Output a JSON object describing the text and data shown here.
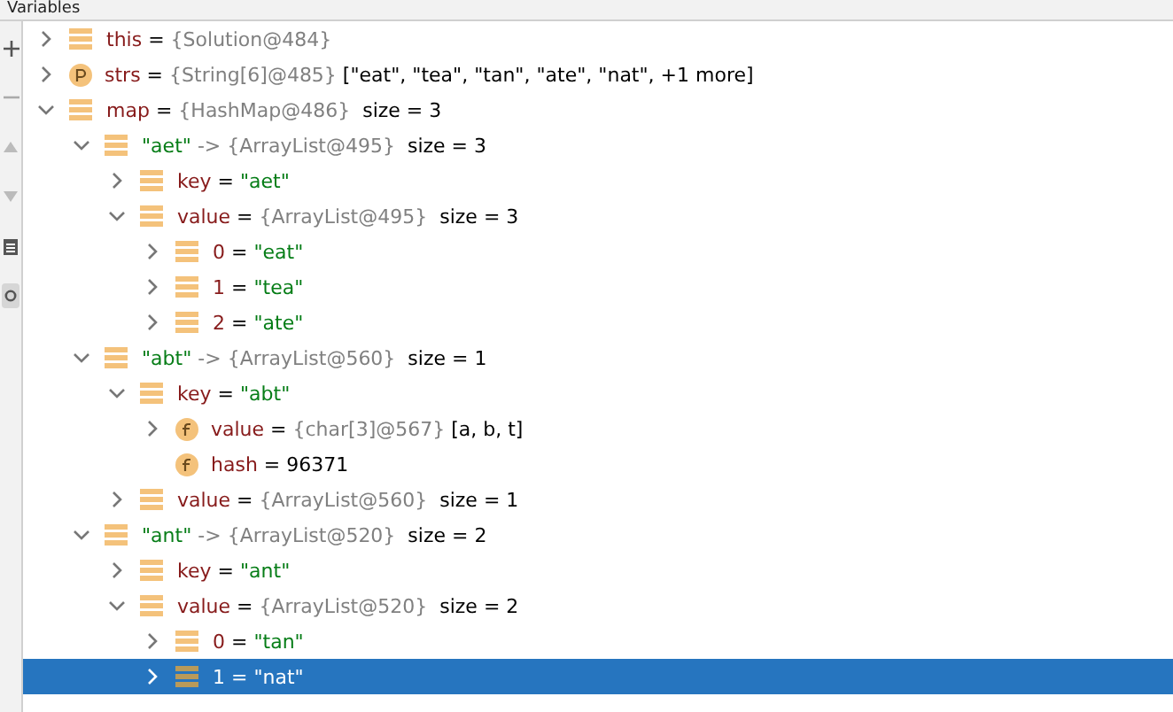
{
  "panel": {
    "title": "Variables"
  },
  "tree": [
    {
      "kind": "list",
      "expanded": false,
      "selected": false,
      "parts": [
        {
          "kind": "name",
          "text": "this"
        },
        {
          "kind": "op",
          "text": " = "
        },
        {
          "kind": "ref",
          "text": "{Solution@484}"
        }
      ]
    },
    {
      "kind": "parameter",
      "expanded": false,
      "selected": false,
      "parts": [
        {
          "kind": "name",
          "text": "strs"
        },
        {
          "kind": "op",
          "text": " = "
        },
        {
          "kind": "ref",
          "text": "{String[6]@485}"
        },
        {
          "kind": "value",
          "text": " [\"eat\", \"tea\", \"tan\", \"ate\", \"nat\", +1 more]"
        }
      ]
    },
    {
      "kind": "list",
      "expanded": true,
      "selected": false,
      "parts": [
        {
          "kind": "name",
          "text": "map"
        },
        {
          "kind": "op",
          "text": " = "
        },
        {
          "kind": "ref",
          "text": "{HashMap@486}"
        },
        {
          "kind": "value",
          "text": "  size = 3"
        }
      ],
      "children": [
        {
          "kind": "list",
          "expanded": true,
          "selected": false,
          "parts": [
            {
              "kind": "string",
              "text": "\"aet\""
            },
            {
              "kind": "ref",
              "text": " -> {ArrayList@495}"
            },
            {
              "kind": "value",
              "text": "  size = 3"
            }
          ],
          "children": [
            {
              "kind": "list",
              "expanded": false,
              "selected": false,
              "parts": [
                {
                  "kind": "name",
                  "text": "key"
                },
                {
                  "kind": "op",
                  "text": " = "
                },
                {
                  "kind": "string",
                  "text": "\"aet\""
                }
              ]
            },
            {
              "kind": "list",
              "expanded": true,
              "selected": false,
              "parts": [
                {
                  "kind": "name",
                  "text": "value"
                },
                {
                  "kind": "op",
                  "text": " = "
                },
                {
                  "kind": "ref",
                  "text": "{ArrayList@495}"
                },
                {
                  "kind": "value",
                  "text": "  size = 3"
                }
              ],
              "children": [
                {
                  "kind": "list",
                  "expanded": false,
                  "selected": false,
                  "parts": [
                    {
                      "kind": "name",
                      "text": "0"
                    },
                    {
                      "kind": "op",
                      "text": " = "
                    },
                    {
                      "kind": "string",
                      "text": "\"eat\""
                    }
                  ]
                },
                {
                  "kind": "list",
                  "expanded": false,
                  "selected": false,
                  "parts": [
                    {
                      "kind": "name",
                      "text": "1"
                    },
                    {
                      "kind": "op",
                      "text": " = "
                    },
                    {
                      "kind": "string",
                      "text": "\"tea\""
                    }
                  ]
                },
                {
                  "kind": "list",
                  "expanded": false,
                  "selected": false,
                  "parts": [
                    {
                      "kind": "name",
                      "text": "2"
                    },
                    {
                      "kind": "op",
                      "text": " = "
                    },
                    {
                      "kind": "string",
                      "text": "\"ate\""
                    }
                  ]
                }
              ]
            }
          ]
        },
        {
          "kind": "list",
          "expanded": true,
          "selected": false,
          "parts": [
            {
              "kind": "string",
              "text": "\"abt\""
            },
            {
              "kind": "ref",
              "text": " -> {ArrayList@560}"
            },
            {
              "kind": "value",
              "text": "  size = 1"
            }
          ],
          "children": [
            {
              "kind": "list",
              "expanded": true,
              "selected": false,
              "parts": [
                {
                  "kind": "name",
                  "text": "key"
                },
                {
                  "kind": "op",
                  "text": " = "
                },
                {
                  "kind": "string",
                  "text": "\"abt\""
                }
              ],
              "children": [
                {
                  "kind": "field",
                  "expanded": false,
                  "selected": false,
                  "parts": [
                    {
                      "kind": "name",
                      "text": "value"
                    },
                    {
                      "kind": "op",
                      "text": " = "
                    },
                    {
                      "kind": "ref",
                      "text": "{char[3]@567}"
                    },
                    {
                      "kind": "value",
                      "text": " [a, b, t]"
                    }
                  ]
                },
                {
                  "kind": "field",
                  "selected": false,
                  "parts": [
                    {
                      "kind": "name",
                      "text": "hash"
                    },
                    {
                      "kind": "op",
                      "text": " = "
                    },
                    {
                      "kind": "value",
                      "text": "96371"
                    }
                  ]
                }
              ]
            },
            {
              "kind": "list",
              "expanded": false,
              "selected": false,
              "parts": [
                {
                  "kind": "name",
                  "text": "value"
                },
                {
                  "kind": "op",
                  "text": " = "
                },
                {
                  "kind": "ref",
                  "text": "{ArrayList@560}"
                },
                {
                  "kind": "value",
                  "text": "  size = 1"
                }
              ]
            }
          ]
        },
        {
          "kind": "list",
          "expanded": true,
          "selected": false,
          "parts": [
            {
              "kind": "string",
              "text": "\"ant\""
            },
            {
              "kind": "ref",
              "text": " -> {ArrayList@520}"
            },
            {
              "kind": "value",
              "text": "  size = 2"
            }
          ],
          "children": [
            {
              "kind": "list",
              "expanded": false,
              "selected": false,
              "parts": [
                {
                  "kind": "name",
                  "text": "key"
                },
                {
                  "kind": "op",
                  "text": " = "
                },
                {
                  "kind": "string",
                  "text": "\"ant\""
                }
              ]
            },
            {
              "kind": "list",
              "expanded": true,
              "selected": false,
              "parts": [
                {
                  "kind": "name",
                  "text": "value"
                },
                {
                  "kind": "op",
                  "text": " = "
                },
                {
                  "kind": "ref",
                  "text": "{ArrayList@520}"
                },
                {
                  "kind": "value",
                  "text": "  size = 2"
                }
              ],
              "children": [
                {
                  "kind": "list",
                  "expanded": false,
                  "selected": false,
                  "parts": [
                    {
                      "kind": "name",
                      "text": "0"
                    },
                    {
                      "kind": "op",
                      "text": " = "
                    },
                    {
                      "kind": "string",
                      "text": "\"tan\""
                    }
                  ]
                },
                {
                  "kind": "list",
                  "expanded": false,
                  "selected": true,
                  "parts": [
                    {
                      "kind": "name",
                      "text": "1"
                    },
                    {
                      "kind": "op",
                      "text": " = "
                    },
                    {
                      "kind": "string",
                      "text": "\"nat\""
                    }
                  ]
                }
              ]
            }
          ]
        }
      ]
    }
  ]
}
